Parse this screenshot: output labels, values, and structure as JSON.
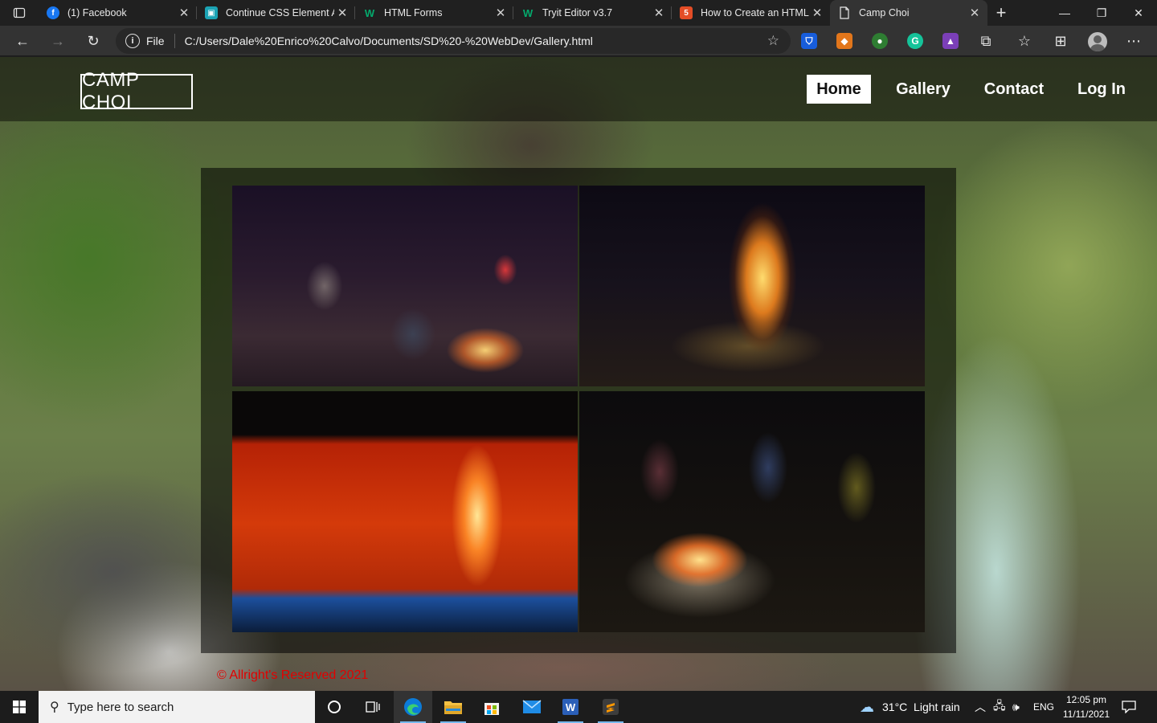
{
  "browser": {
    "tabs": [
      {
        "title": "(1) Facebook",
        "favicon": "facebook-icon",
        "color": "#1877f2"
      },
      {
        "title": "Continue CSS Element A",
        "favicon": "classroom-icon",
        "color": "#1ba3b4"
      },
      {
        "title": "HTML Forms",
        "favicon": "w3schools-icon",
        "color": "#04aa6d"
      },
      {
        "title": "Tryit Editor v3.7",
        "favicon": "w3schools-icon",
        "color": "#04aa6d"
      },
      {
        "title": "How to Create an HTML",
        "favicon": "html-tutorial-icon",
        "color": "#e44d26"
      },
      {
        "title": "Camp Choi",
        "favicon": "page-icon",
        "color": "#ffffff"
      }
    ],
    "address": {
      "scheme": "File",
      "url": "C:/Users/Dale%20Enrico%20Calvo/Documents/SD%20-%20WebDev/Gallery.html"
    }
  },
  "site": {
    "logo": "CAMP CHOI",
    "nav": [
      "Home",
      "Gallery",
      "Contact",
      "Log In"
    ],
    "active_nav": "Home",
    "gallery": [
      {
        "alt": "campfire-group-night"
      },
      {
        "alt": "bonfire-forest-night"
      },
      {
        "alt": "tent-heart-hands"
      },
      {
        "alt": "campfire-couple-chairs"
      }
    ],
    "footer": "© Allright's Reserved 2021",
    "colors": {
      "footer_text": "#e20000",
      "nav_active_bg": "#ffffff"
    }
  },
  "taskbar": {
    "search_placeholder": "Type here to search",
    "weather": "31°C  Light rain",
    "language": "ENG",
    "time": "12:05 pm",
    "date": "11/11/2021"
  }
}
